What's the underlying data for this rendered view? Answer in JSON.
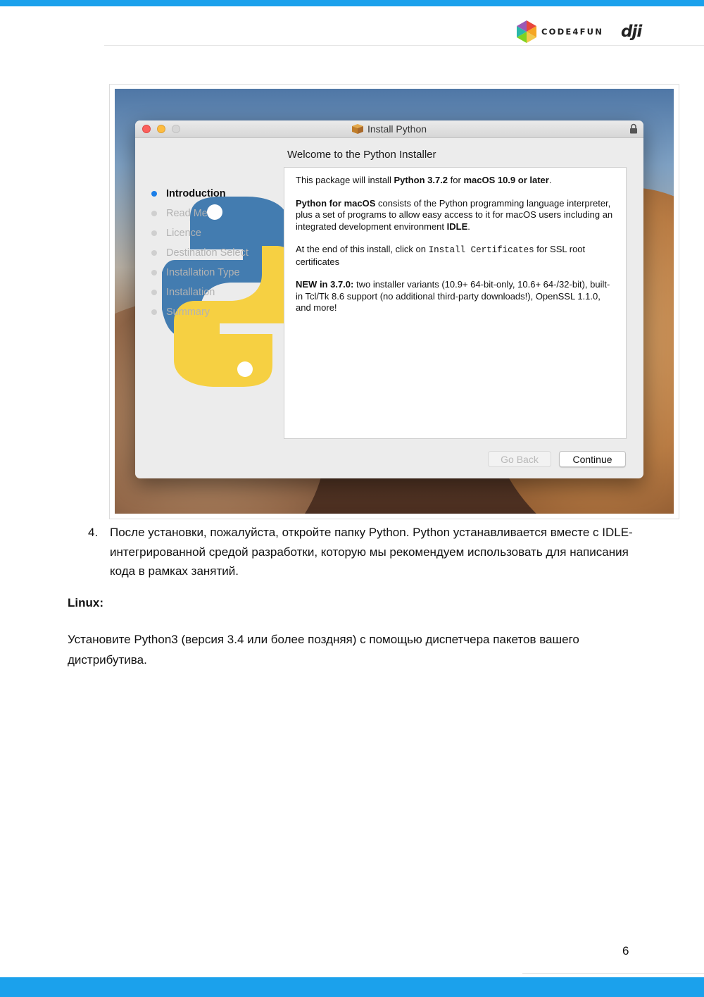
{
  "header": {
    "brand_code4fun": "CODE4FUN",
    "brand_dji": "dji"
  },
  "installer": {
    "window_title": "Install Python",
    "heading": "Welcome to the Python Installer",
    "sidebar_steps": [
      {
        "label": "Introduction",
        "active": true
      },
      {
        "label": "Read Me",
        "active": false
      },
      {
        "label": "Licence",
        "active": false
      },
      {
        "label": "Destination Select",
        "active": false
      },
      {
        "label": "Installation Type",
        "active": false
      },
      {
        "label": "Installation",
        "active": false
      },
      {
        "label": "Summary",
        "active": false
      }
    ],
    "content": {
      "p1_a": "This package will install ",
      "p1_b": "Python 3.7.2",
      "p1_c": " for ",
      "p1_d": "macOS 10.9 or later",
      "p1_e": ".",
      "p2_a": "Python for macOS",
      "p2_b": " consists of the Python programming language interpreter, plus a set of programs to allow easy access to it for macOS users including an integrated development environment ",
      "p2_c": "IDLE",
      "p2_d": ".",
      "p3_a": "At the end of this install, click on ",
      "p3_b": "Install Certificates",
      "p3_c": " for SSL root certificates",
      "p4_a": "NEW in 3.7.0:",
      "p4_b": " two installer variants (10.9+ 64-bit-only, 10.6+ 64-/32-bit), built-in Tcl/Tk 8.6 support (no additional third-party downloads!), OpenSSL 1.1.0, and more!"
    },
    "buttons": {
      "back": "Go Back",
      "continue": "Continue"
    },
    "colors": {
      "active_dot": "#1b7ee8",
      "close": "#fc605c",
      "minimize": "#fdbc40"
    }
  },
  "doc": {
    "step_number": "4.",
    "step_text": "После установки, пожалуйста, откройте папку Python. Python устанавливается вместе с IDLE-интегрированной средой разработки, которую мы рекомендуем использовать для написания кода в рамках занятий.",
    "linux_heading": "Linux:",
    "linux_text": "Установите Python3 (версия 3.4 или более поздняя) с помощью диспетчера пакетов вашего дистрибутива.",
    "page_number": "6"
  },
  "theme": {
    "accent_bar": "#1ba1ec"
  }
}
